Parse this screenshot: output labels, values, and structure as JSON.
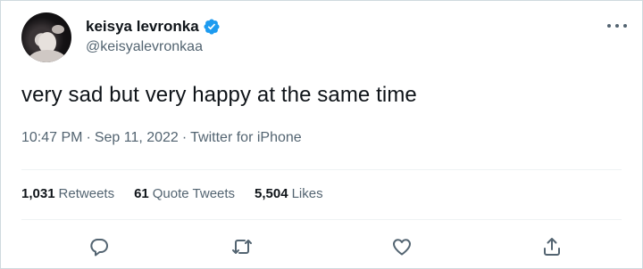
{
  "author": {
    "display_name": "keisya levronka",
    "handle": "@keisyalevronkaa",
    "avatar_icon": "profile-photo",
    "verified_icon": "verified-badge-icon"
  },
  "tweet": {
    "text": "very sad but very happy at the same time",
    "time": "10:47 PM",
    "separator_1": "·",
    "date": "Sep 11, 2022",
    "separator_2": "·",
    "source": "Twitter for iPhone"
  },
  "stats": [
    {
      "count": "1,031",
      "label": "Retweets"
    },
    {
      "count": "61",
      "label": "Quote Tweets"
    },
    {
      "count": "5,504",
      "label": "Likes"
    }
  ],
  "actions": [
    "reply-icon",
    "retweet-icon",
    "like-icon",
    "share-icon"
  ],
  "colors": {
    "verified": "#1d9bf0",
    "secondary_text": "#536471",
    "primary_text": "#0f1419",
    "divider": "#eff3f4"
  }
}
